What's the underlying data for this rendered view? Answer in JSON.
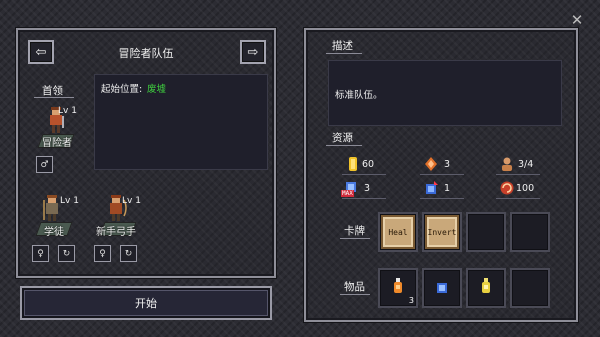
{
  "close_icon": "✕",
  "team_panel": {
    "title": "冒险者队伍",
    "prev_arrow": "⇦",
    "next_arrow": "⇨",
    "leader_label": "首领",
    "start_position_label": "起始位置:",
    "start_position_value": "废墟",
    "leader": {
      "level": "Lv 1",
      "name": "冒险者",
      "gender_symbol": "♂"
    },
    "members": [
      {
        "level": "Lv 1",
        "name": "学徒",
        "gender_symbol": "♀",
        "refresh_symbol": "↻"
      },
      {
        "level": "Lv 1",
        "name": "新手弓手",
        "gender_symbol": "♀",
        "refresh_symbol": "↻"
      }
    ],
    "start_button": "开始"
  },
  "info_panel": {
    "description_label": "描述",
    "description_text": "标准队伍。",
    "resources_label": "资源",
    "resources": {
      "gold": "60",
      "crystal": "3",
      "party": "3/4",
      "max_item": "3",
      "up_item": "1",
      "swirl": "100"
    },
    "max_badge": "MAX",
    "cards_label": "卡牌",
    "cards": [
      "Heal",
      "Invert"
    ],
    "items_label": "物品",
    "items_first_count": "3"
  },
  "colors": {
    "start_position_value": "#3fd03f",
    "card_bg": "#c9a87a"
  }
}
